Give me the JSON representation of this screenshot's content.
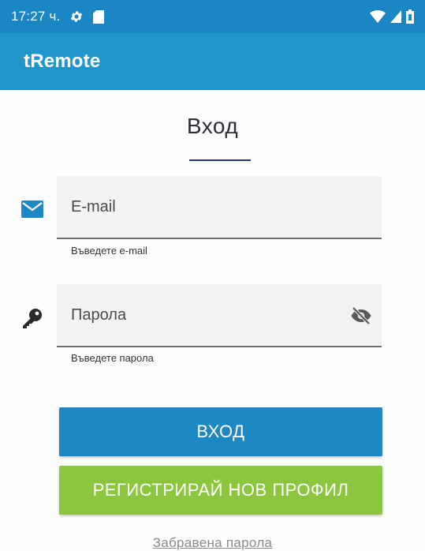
{
  "status_bar": {
    "time": "17:27 ч.",
    "icons": [
      "gear-icon",
      "sd-card-icon",
      "wifi-icon",
      "signal-icon",
      "battery-icon"
    ]
  },
  "app_bar": {
    "title": "tRemote"
  },
  "login": {
    "title": "Вход",
    "email": {
      "placeholder": "E-mail",
      "helper": "Въведете e-mail",
      "icon": "mail-icon"
    },
    "password": {
      "placeholder": "Парола",
      "helper": "Въведете парола",
      "icon": "key-icon",
      "toggle_icon": "eye-off-icon"
    },
    "login_button": "ВХОД",
    "register_button": "РЕГИСТРИРАЙ НОВ ПРОФИЛ",
    "forgot_password": "Забравена парола"
  },
  "colors": {
    "status_bar": "#1b86c4",
    "app_bar": "#2196cd",
    "login_button": "#1e88c4",
    "register_button": "#8cc63f",
    "accent_icon": "#1e88c4"
  }
}
